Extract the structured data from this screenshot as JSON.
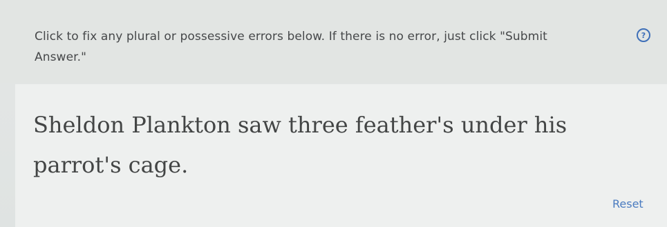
{
  "header": {
    "instructions": "Click to fix any plural or possessive errors below. If there is no error, just click \"Submit Answer.\"",
    "help_icon": "question-circle-icon",
    "help_glyph": "?"
  },
  "question": {
    "words": [
      "Sheldon",
      "Plankton",
      "saw",
      "three",
      "feather's",
      "under",
      "his",
      "parrot's",
      "cage."
    ]
  },
  "footer": {
    "reset_label": "Reset"
  },
  "colors": {
    "accent": "#3e6fb8",
    "link": "#4a7bc0",
    "text": "#434545"
  }
}
